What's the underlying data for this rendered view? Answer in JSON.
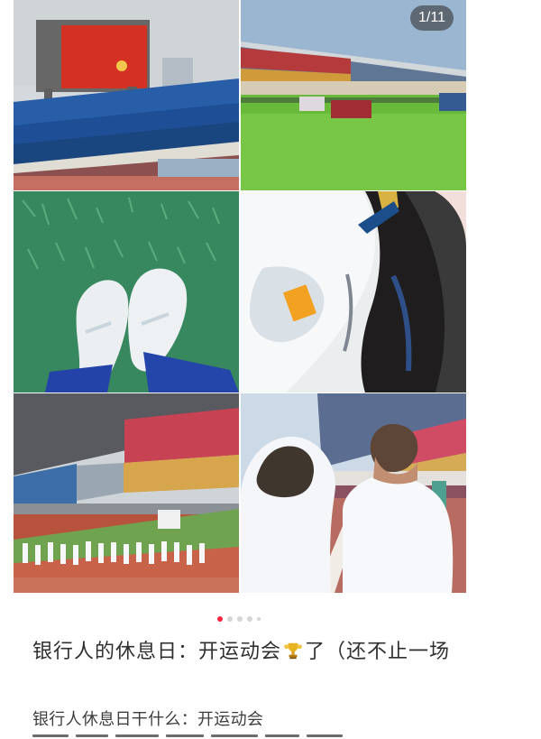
{
  "gallery": {
    "counter": "1/11"
  },
  "post": {
    "title_part1": "银行人的休息日：开运动会",
    "title_part2": "了（还不止一场",
    "body_line1": "银行人休息日干什么：开运动会"
  },
  "colors": {
    "accent": "#ff2442",
    "text_primary": "#2f2f2f",
    "text_secondary": "#3e3e3e"
  },
  "icons": {
    "trophy": "trophy-icon"
  }
}
